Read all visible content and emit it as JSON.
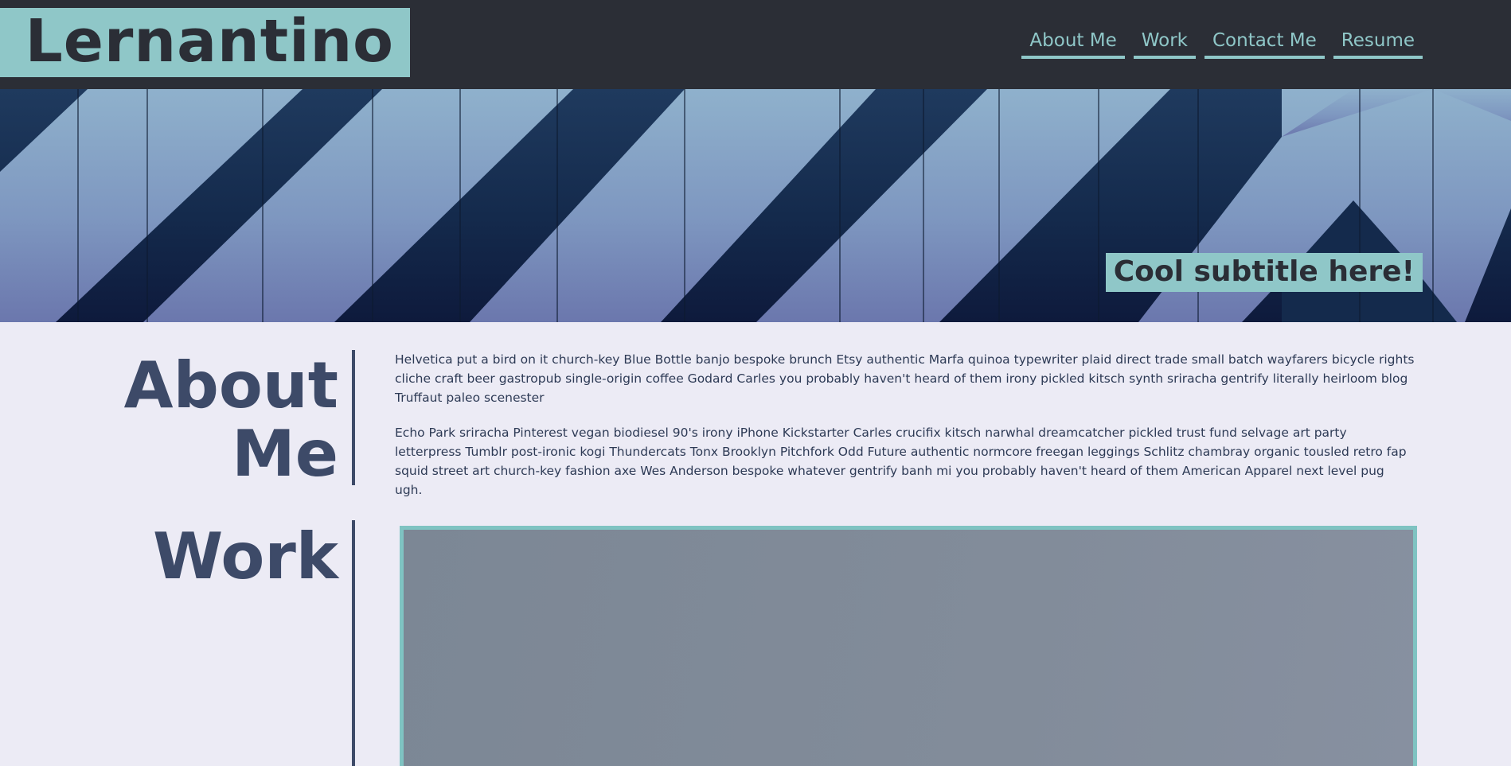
{
  "header": {
    "logo": "Lernantino",
    "nav": [
      {
        "label": "About Me"
      },
      {
        "label": "Work"
      },
      {
        "label": "Contact Me"
      },
      {
        "label": "Resume"
      }
    ]
  },
  "hero": {
    "subtitle": "Cool subtitle here!"
  },
  "about": {
    "heading_line1": "About",
    "heading_line2": "Me",
    "paragraphs": [
      "Helvetica put a bird on it church-key Blue Bottle banjo bespoke brunch Etsy authentic Marfa quinoa typewriter plaid direct trade small batch wayfarers bicycle rights cliche craft beer gastropub single-origin coffee Godard Carles you probably haven't heard of them irony pickled kitsch synth sriracha gentrify literally heirloom blog Truffaut paleo scenester",
      "Echo Park sriracha Pinterest vegan biodiesel 90's irony iPhone Kickstarter Carles crucifix kitsch narwhal dreamcatcher pickled trust fund selvage art party letterpress Tumblr post-ironic kogi Thundercats Tonx Brooklyn Pitchfork Odd Future authentic normcore freegan leggings Schlitz chambray organic tousled retro fap squid street art church-key fashion axe Wes Anderson bespoke whatever gentrify banh mi you probably haven't heard of them American Apparel next level pug ugh."
    ]
  },
  "work": {
    "heading": "Work"
  },
  "colors": {
    "header_bg": "#2b2e36",
    "accent": "#8fc7c8",
    "heading": "#3d4a68",
    "page_bg": "#ecebf5"
  }
}
